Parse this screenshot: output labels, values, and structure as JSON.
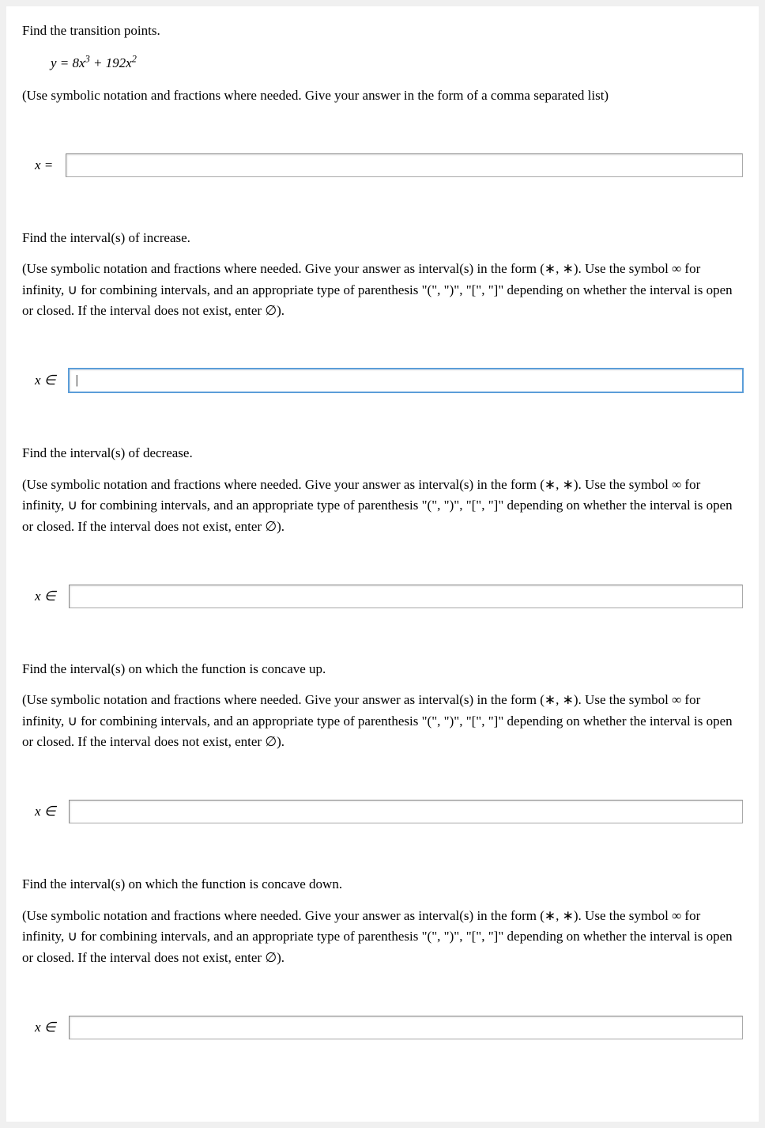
{
  "q1": {
    "prompt": "Find the transition points.",
    "equation_html": "y = 8x<sup>3</sup> + 192x<sup>2</sup>",
    "instructions": "(Use symbolic notation and fractions where needed. Give your answer in the form of a comma separated list)",
    "label": "x =",
    "value": ""
  },
  "q2": {
    "prompt": "Find the interval(s) of increase.",
    "instructions": "(Use symbolic notation and fractions where needed. Give your answer as interval(s) in the form (∗, ∗). Use the symbol ∞ for infinity, ∪ for combining intervals, and an appropriate type of parenthesis \"(\", \")\", \"[\", \"]\" depending on whether the interval is open or closed. If the interval does not exist, enter ∅).",
    "label": "x ∈",
    "value": "|"
  },
  "q3": {
    "prompt": "Find the interval(s) of decrease.",
    "instructions": "(Use symbolic notation and fractions where needed. Give your answer as interval(s) in the form (∗, ∗). Use the symbol ∞ for infinity, ∪ for combining intervals, and an appropriate type of parenthesis \"(\", \")\", \"[\", \"]\" depending on whether the interval is open or closed. If the interval does not exist, enter ∅).",
    "label": "x ∈",
    "value": ""
  },
  "q4": {
    "prompt": "Find the interval(s) on which the function is concave up.",
    "instructions": "(Use symbolic notation and fractions where needed. Give your answer as interval(s) in the form (∗, ∗). Use the symbol ∞ for infinity, ∪ for combining intervals, and an appropriate type of parenthesis \"(\", \")\", \"[\", \"]\" depending on whether the interval is open or closed. If the interval does not exist, enter ∅).",
    "label": "x ∈",
    "value": ""
  },
  "q5": {
    "prompt": "Find the interval(s) on which the function is concave down.",
    "instructions": "(Use symbolic notation and fractions where needed. Give your answer as interval(s) in the form (∗, ∗). Use the symbol ∞ for infinity, ∪ for combining intervals, and an appropriate type of parenthesis \"(\", \")\", \"[\", \"]\" depending on whether the interval is open or closed. If the interval does not exist, enter ∅).",
    "label": "x ∈",
    "value": ""
  }
}
